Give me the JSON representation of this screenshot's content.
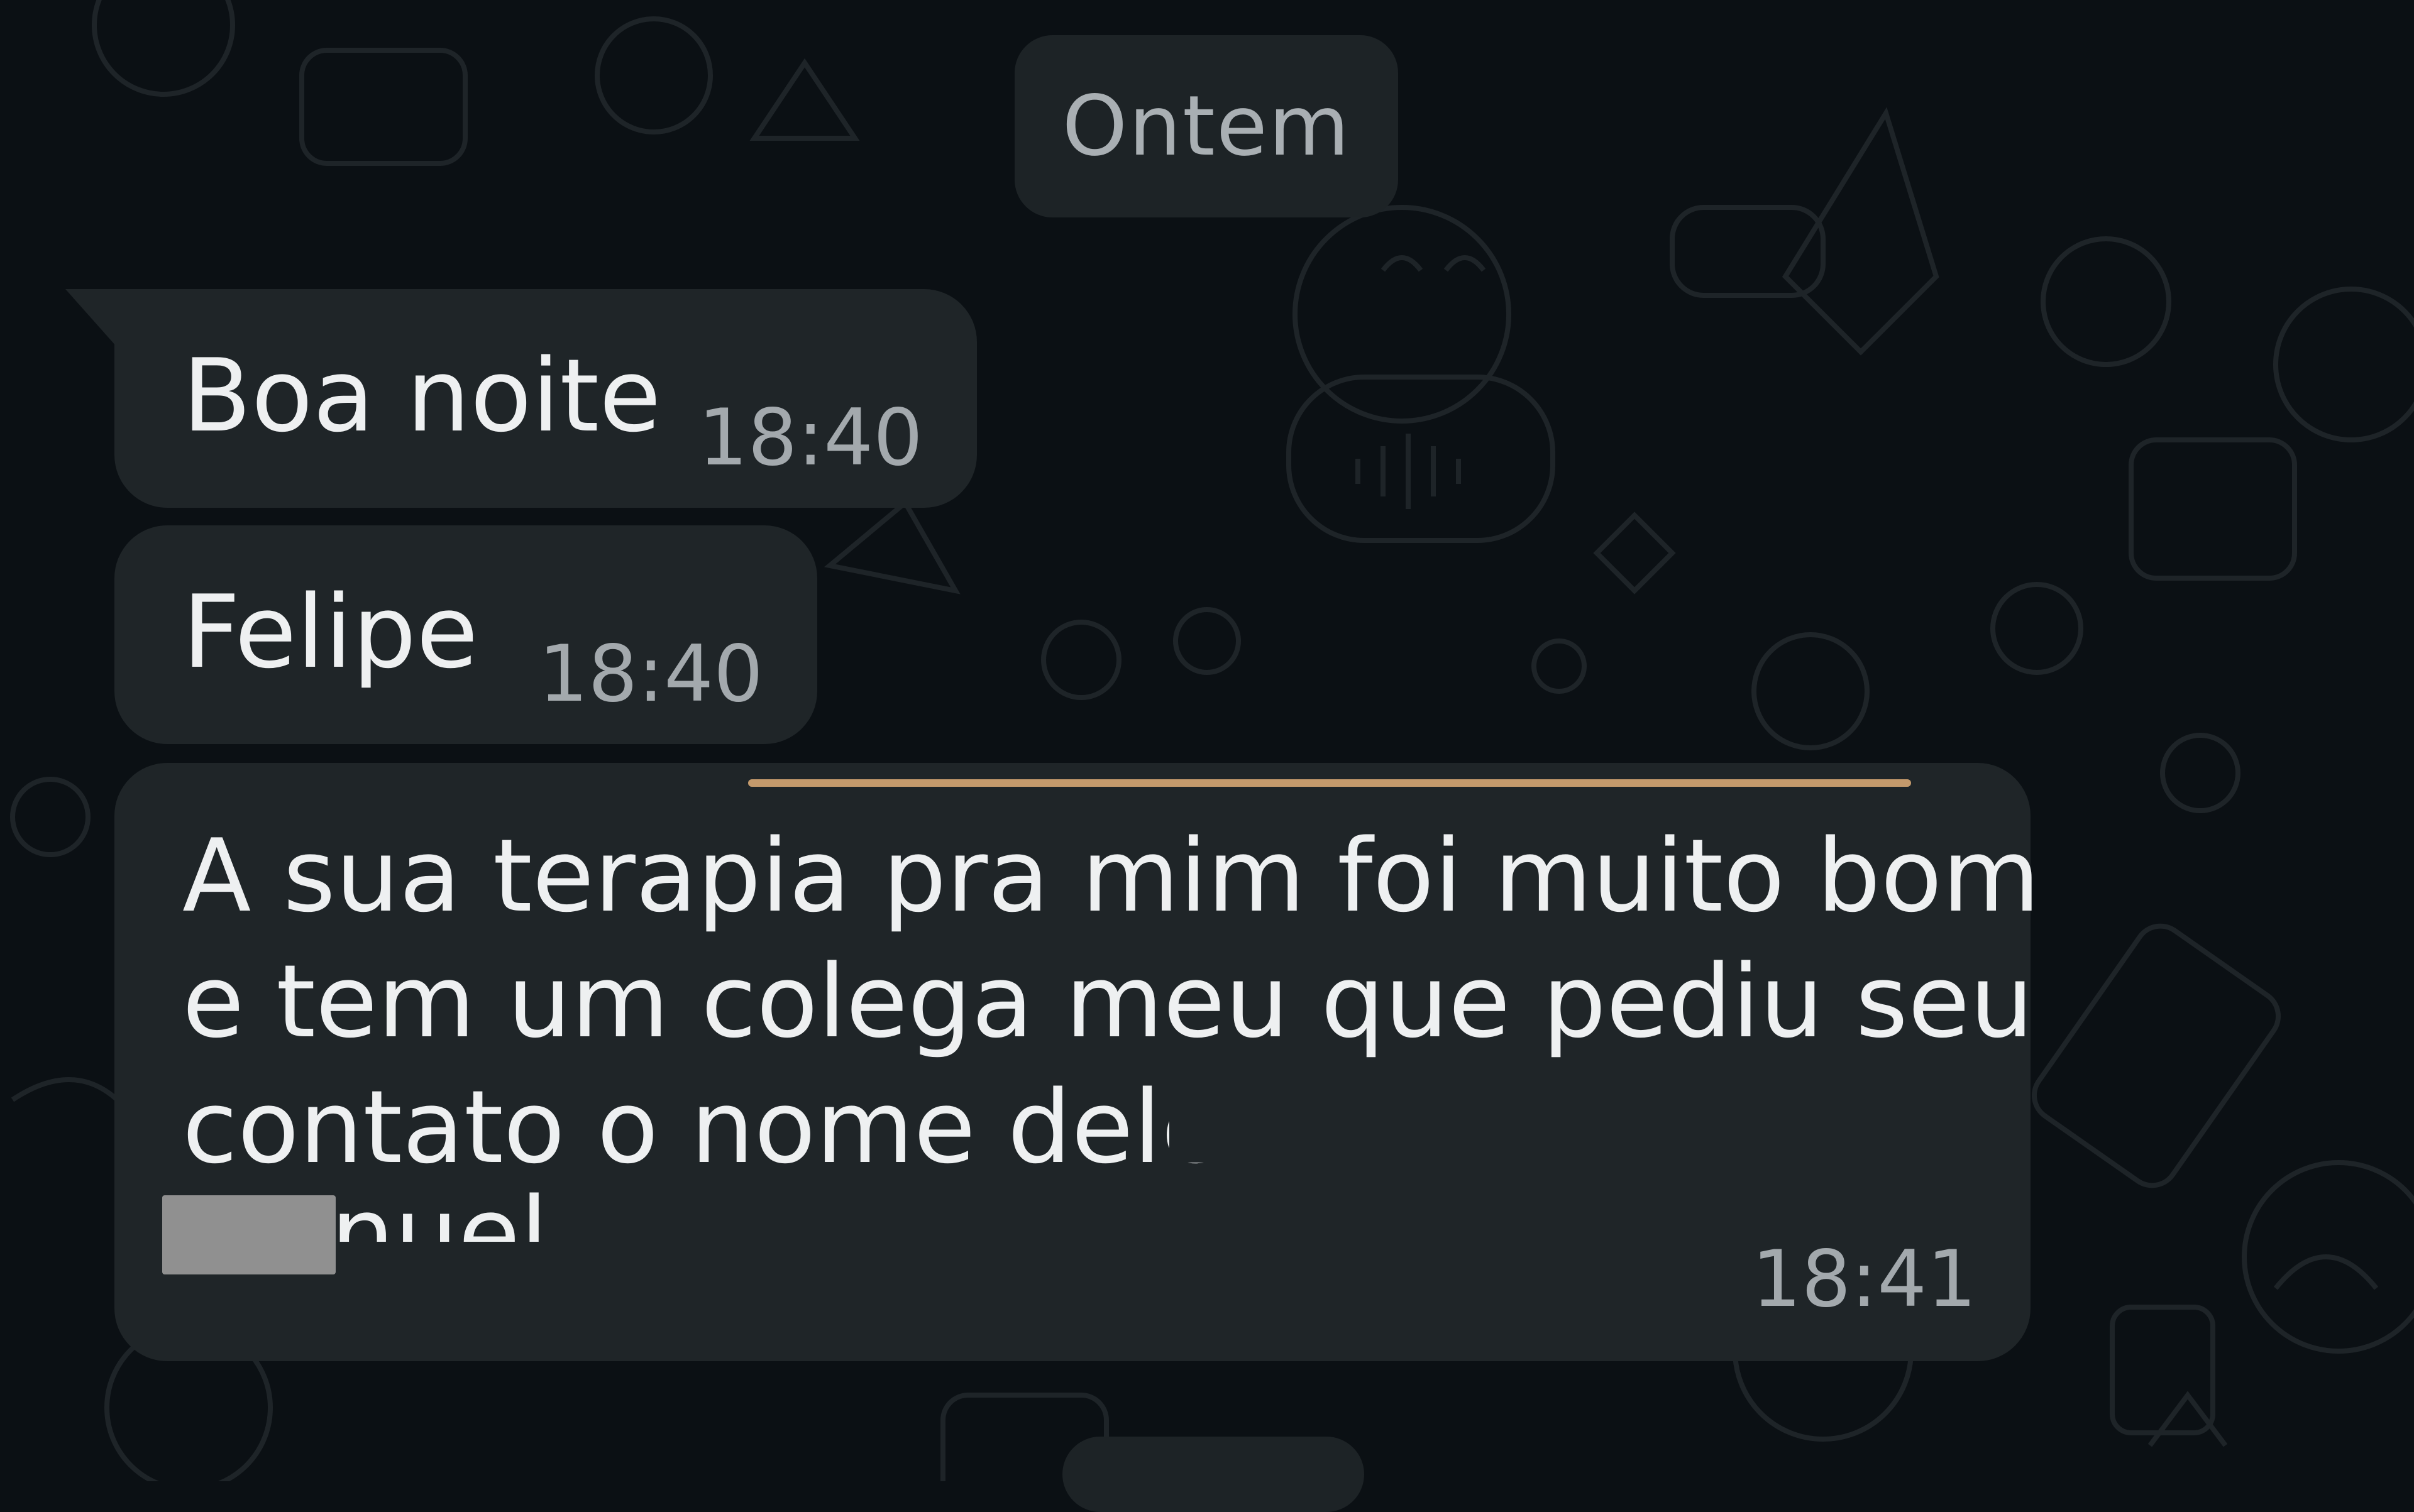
{
  "date_separator": "Ontem",
  "messages": [
    {
      "text": "Boa noite",
      "time": "18:40"
    },
    {
      "text": "Felipe",
      "time": "18:40"
    },
    {
      "lines": [
        "A sua terapia pra mim foi muito bom",
        "e tem um colega meu que pediu seu",
        "contato o nome dele",
        "Manuel"
      ],
      "time": "18:41"
    }
  ],
  "colors": {
    "background": "#0b1014",
    "bubble": "#1f2528",
    "underline": "#c49a6c"
  }
}
